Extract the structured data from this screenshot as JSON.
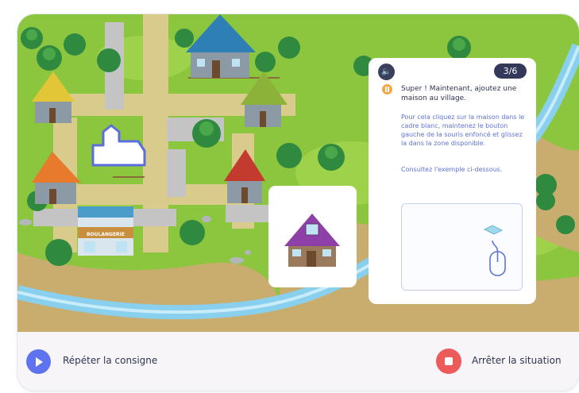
{
  "panel": {
    "counter": "3/6",
    "message_main": "Super ! Maintenant, ajoutez une maison au village.",
    "message_instructions": "Pour cela cliquez sur la maison dans le cadre blanc, maintenez le bouton gauche de la souris enfoncé et glissez la dans la zone disponible.",
    "message_example": "Consultez l'exemple ci-dessous."
  },
  "scene": {
    "bakery_sign": "BOULANGERIE"
  },
  "bottom_bar": {
    "repeat_label": "Répéter la consigne",
    "stop_label": "Arrêter la situation"
  },
  "icons": {
    "audio": "speaker-icon",
    "pause": "pause-icon",
    "repeat": "play-icon",
    "stop": "stop-icon",
    "mouse": "mouse-icon",
    "drop_target": "tile-icon"
  },
  "colors": {
    "grass": "#8cc63e",
    "road": "#d8cb8b",
    "river": "#89cfee",
    "panel_text": "#2f3550",
    "accent_blue": "#5f73ee",
    "accent_red": "#ec5a5a",
    "accent_orange": "#f6a640",
    "counter_bg": "#34395a",
    "instruction_blue": "#5f73d6"
  }
}
